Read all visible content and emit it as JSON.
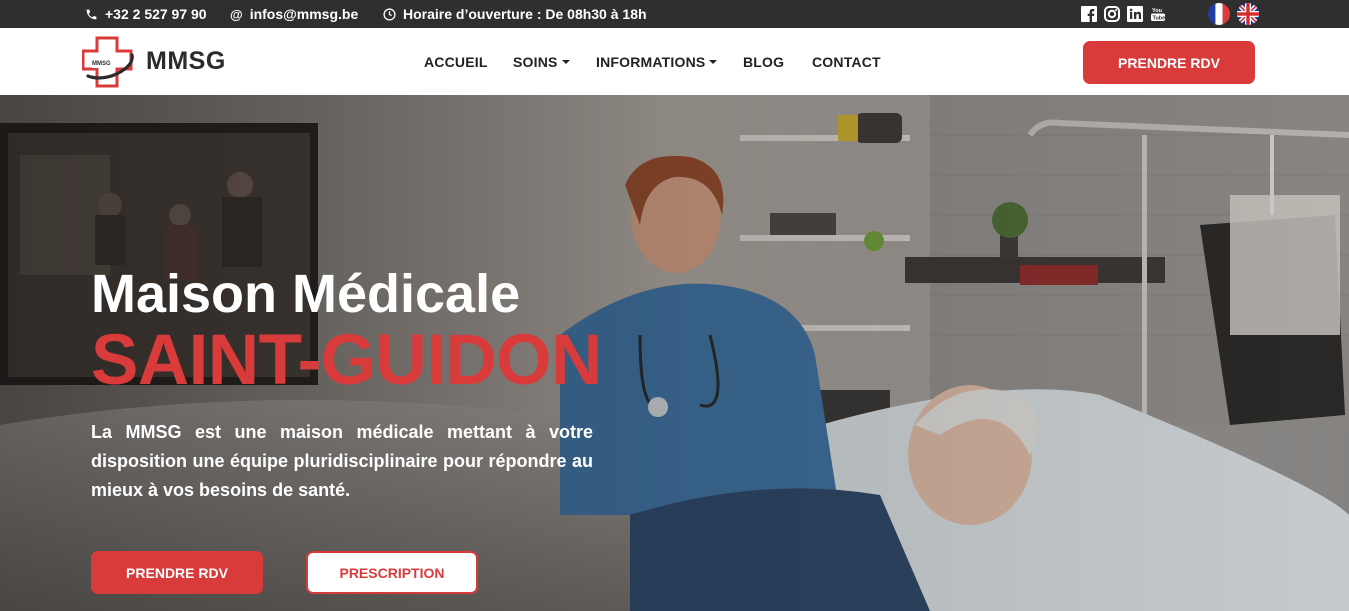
{
  "topbar": {
    "phone": "+32 2 527 97 90",
    "email": "infos@mmsg.be",
    "hours": "Horaire d’ouverture : De 08h30 à 18h",
    "social_icons": [
      "facebook-icon",
      "instagram-icon",
      "linkedin-icon",
      "youtube-icon"
    ],
    "languages": [
      "fr-flag-icon",
      "uk-flag-icon"
    ]
  },
  "nav": {
    "brand": "MMSG",
    "logo_text": "MMSG",
    "items": [
      {
        "label": "ACCUEIL"
      },
      {
        "label": "SOINS"
      },
      {
        "label": "INFORMATIONS"
      },
      {
        "label": "BLOG"
      },
      {
        "label": "CONTACT"
      }
    ],
    "cta": "PRENDRE RDV"
  },
  "hero": {
    "title": "Maison Médicale",
    "subtitle": "SAINT-GUIDON",
    "description": "La MMSG est une maison médicale mettant à votre disposition une équipe pluridisciplinaire pour répondre au mieux à vos besoins de santé.",
    "primary_button": "PRENDRE RDV",
    "secondary_button": "PRESCRIPTION"
  },
  "colors": {
    "accent": "#d93b3b",
    "topbar": "#2f2f2f",
    "text_dark": "#222222"
  }
}
